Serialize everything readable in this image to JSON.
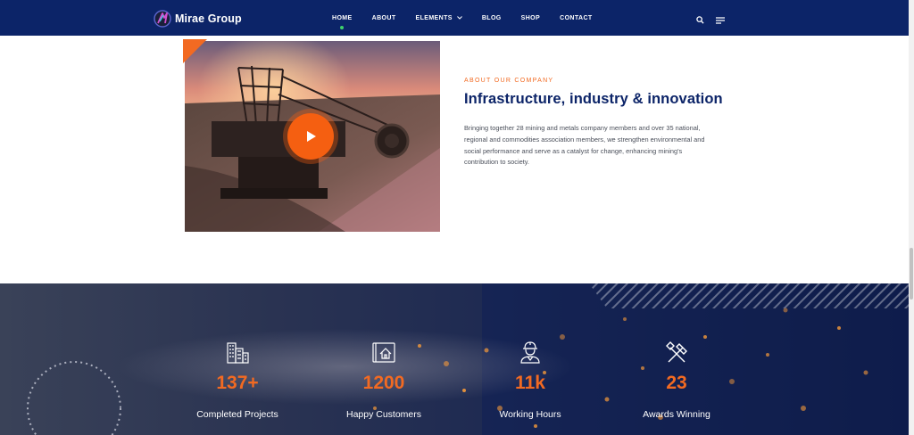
{
  "header": {
    "logo_text": "Mirae Group",
    "nav": [
      {
        "label": "HOME",
        "active": true
      },
      {
        "label": "ABOUT"
      },
      {
        "label": "ELEMENTS",
        "dropdown": true
      },
      {
        "label": "BLOG"
      },
      {
        "label": "SHOP"
      },
      {
        "label": "CONTACT"
      }
    ],
    "icons": [
      "search-icon",
      "menu-lines-icon"
    ]
  },
  "about": {
    "eyebrow": "ABOUT OUR COMPANY",
    "heading": "Infrastructure, industry & innovation",
    "body": "Bringing together 28 mining and metals company members and over 35 national, regional and commodities association members, we strengthen environmental and social performance and serve as a catalyst for change, enhancing mining's contribution to society.",
    "video_icon": "play-icon"
  },
  "stats": [
    {
      "number": "137+",
      "label": "Completed Projects",
      "icon": "buildings-icon"
    },
    {
      "number": "1200",
      "label": "Happy Customers",
      "icon": "blueprint-house-icon"
    },
    {
      "number": "11k",
      "label": "Working Hours",
      "icon": "worker-icon"
    },
    {
      "number": "23",
      "label": "Awards Winning",
      "icon": "crossed-hammers-icon"
    }
  ],
  "colors": {
    "header_bg": "#0c2468",
    "accent": "#f26a22",
    "heading": "#0c2468",
    "active_dot": "#3ed26b"
  }
}
